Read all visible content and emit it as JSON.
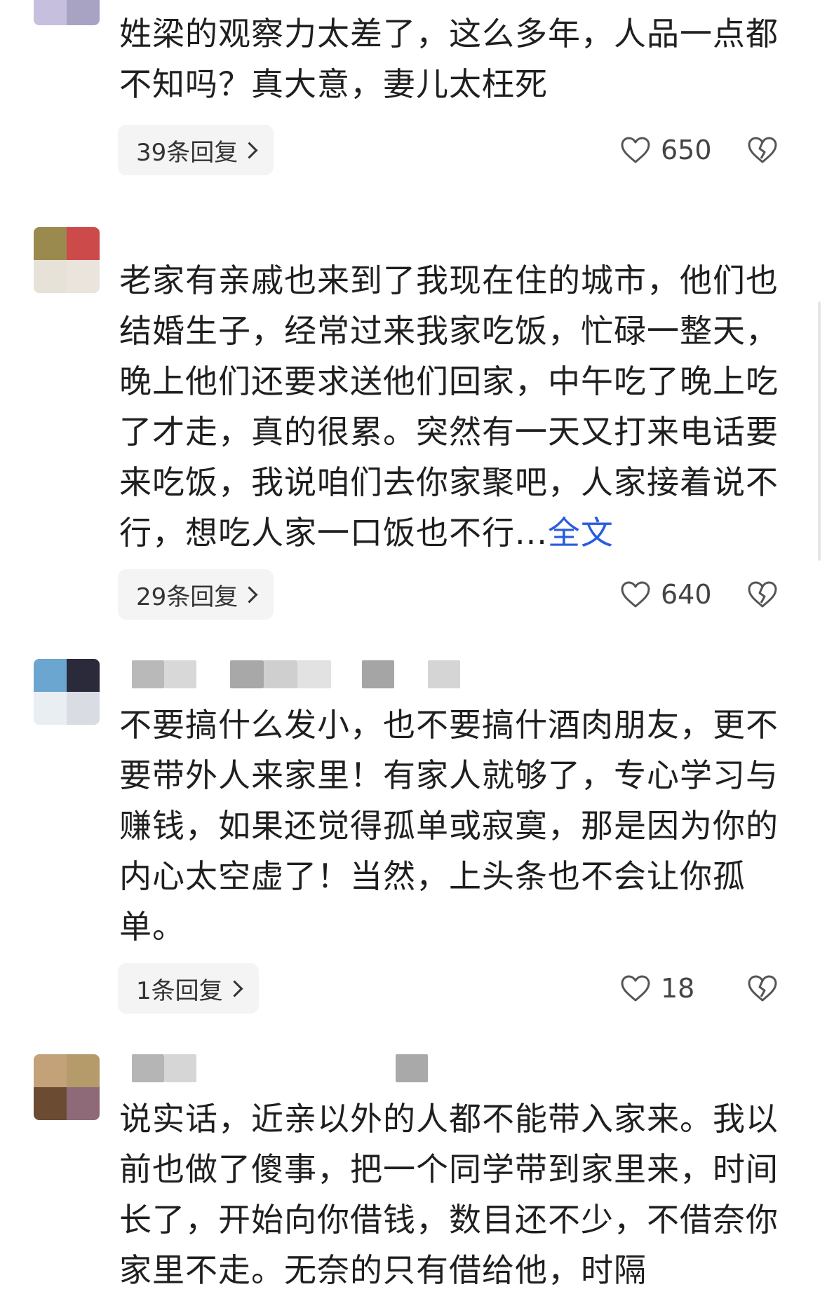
{
  "comments": [
    {
      "body": "姓梁的观察力太差了，这么多年，人品一点都不知吗？真大意，妻儿太枉死",
      "more": "",
      "reply_label": "39条回复",
      "likes": "650"
    },
    {
      "body": "老家有亲戚也来到了我现在住的城市，他们也结婚生子，经常过来我家吃饭，忙碌一整天，晚上他们还要求送他们回家，中午吃了晚上吃了才走，真的很累。突然有一天又打来电话要来吃饭，我说咱们去你家聚吧，人家接着说不行，想吃人家一口饭也不行...",
      "more": "全文",
      "reply_label": "29条回复",
      "likes": "640"
    },
    {
      "body": "不要搞什么发小，也不要搞什酒肉朋友，更不要带外人来家里！有家人就够了，专心学习与赚钱，如果还觉得孤单或寂寞，那是因为你的内心太空虚了！当然，上头条也不会让你孤单。",
      "more": "",
      "reply_label": "1条回复",
      "likes": "18"
    },
    {
      "body": "说实话，近亲以外的人都不能带入家来。我以前也做了傻事，把一个同学带到家里来，时间长了，开始向你借钱，数目还不少，不借奈你家里不走。无奈的只有借给他，时隔",
      "more": "",
      "reply_label": "",
      "likes": ""
    }
  ],
  "icons": {
    "like": "heart-outline-icon",
    "dislike": "broken-heart-icon",
    "reply_chevron": "chevron-right-icon"
  },
  "colors": {
    "text": "#1f1f1f",
    "link": "#2a5ddb",
    "reply_bg": "#f4f4f4",
    "icon": "#555555"
  }
}
